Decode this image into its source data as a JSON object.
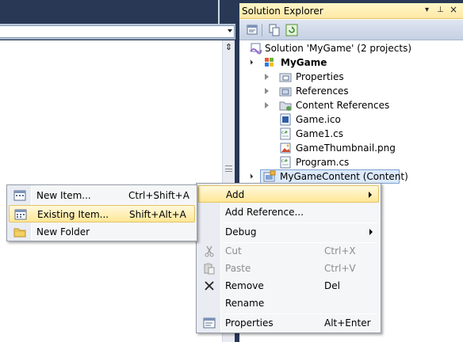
{
  "solution_explorer": {
    "title": "Solution Explorer",
    "title_controls": {
      "dropdown": "▾",
      "pin": "⊥",
      "close": "×"
    }
  },
  "tree": {
    "solution": "Solution 'MyGame' (2 projects)",
    "project1": "MyGame",
    "items": [
      "Properties",
      "References",
      "Content References",
      "Game.ico",
      "Game1.cs",
      "GameThumbnail.png",
      "Program.cs"
    ],
    "project2": "MyGameContent (Content)"
  },
  "context_menu": {
    "items": [
      {
        "label": "Add",
        "shortcut": "",
        "submenu": true,
        "highlighted": true
      },
      {
        "label": "Add Reference...",
        "shortcut": ""
      },
      {
        "label": "Debug",
        "shortcut": "",
        "submenu": true
      },
      {
        "label": "Cut",
        "shortcut": "Ctrl+X",
        "disabled": true
      },
      {
        "label": "Paste",
        "shortcut": "Ctrl+V",
        "disabled": true
      },
      {
        "label": "Remove",
        "shortcut": "Del"
      },
      {
        "label": "Rename",
        "shortcut": ""
      },
      {
        "label": "Properties",
        "shortcut": "Alt+Enter"
      }
    ]
  },
  "add_submenu": {
    "items": [
      {
        "label": "New Item...",
        "shortcut": "Ctrl+Shift+A"
      },
      {
        "label": "Existing Item...",
        "shortcut": "Shift+Alt+A",
        "highlighted": true
      },
      {
        "label": "New Folder",
        "shortcut": ""
      }
    ]
  },
  "colors": {
    "chrome": "#293955",
    "title_active": "#ffe8a6",
    "menu_highlight": "#ffe796",
    "selection": "#dbe9fb"
  },
  "icons": {
    "solution": "solution-icon",
    "project": "windows-project-icon",
    "properties": "properties-folder-icon",
    "references": "references-icon",
    "content_references": "content-references-icon",
    "ico": "icon-file-icon",
    "cs": "csharp-file-icon",
    "png": "image-file-icon",
    "content_project": "content-project-icon",
    "cut": "scissors-icon",
    "paste": "paste-icon",
    "remove": "delete-x-icon",
    "properties_menu": "properties-icon",
    "new_item": "new-item-icon",
    "existing_item": "existing-item-icon",
    "new_folder": "folder-icon"
  }
}
